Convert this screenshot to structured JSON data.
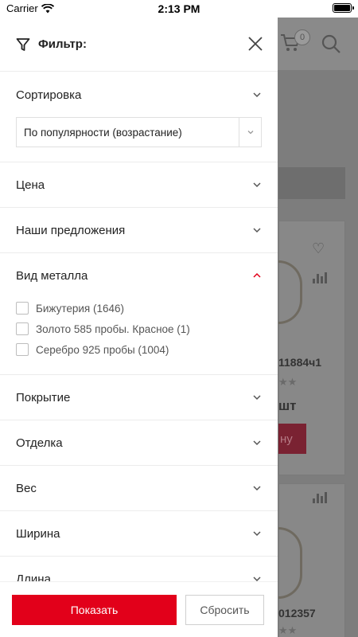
{
  "status_bar": {
    "carrier": "Carrier",
    "time": "2:13 PM"
  },
  "background": {
    "cart_count": "0",
    "sku1": "11884ч1",
    "sku2": "012357",
    "unit": "шт",
    "buy_fragment": "ну",
    "stars": "★★"
  },
  "drawer": {
    "title": "Фильтр:",
    "sort": {
      "label": "Сортировка",
      "selected": "По популярности (возрастание)"
    },
    "sections": [
      {
        "label": "Цена",
        "expanded": false
      },
      {
        "label": "Наши предложения",
        "expanded": false
      },
      {
        "label": "Вид металла",
        "expanded": true
      },
      {
        "label": "Покрытие",
        "expanded": false
      },
      {
        "label": "Отделка",
        "expanded": false
      },
      {
        "label": "Вес",
        "expanded": false
      },
      {
        "label": "Ширина",
        "expanded": false
      },
      {
        "label": "Длина",
        "expanded": false
      }
    ],
    "metal_options": [
      {
        "label": "Бижутерия (1646)",
        "checked": false
      },
      {
        "label": "Золото 585 пробы. Красное (1)",
        "checked": false
      },
      {
        "label": "Серебро 925 пробы (1004)",
        "checked": false
      }
    ],
    "buttons": {
      "show": "Показать",
      "reset": "Сбросить"
    }
  },
  "colors": {
    "accent": "#e2001a",
    "overlay": "#7f7f7f"
  }
}
